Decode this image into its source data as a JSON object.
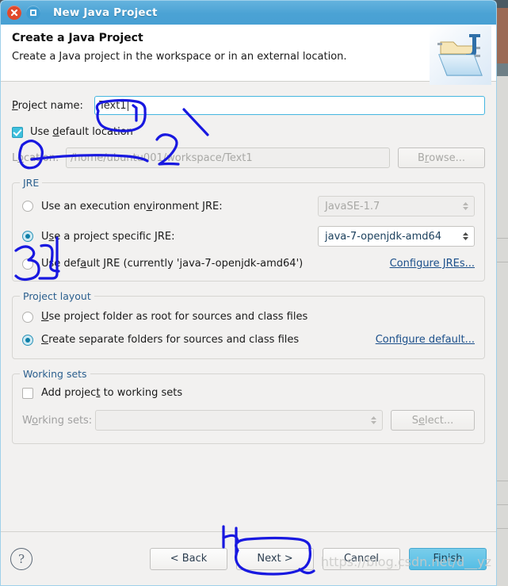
{
  "window": {
    "title": "New Java Project",
    "close_icon": "close-icon",
    "maximize_icon": "maximize-icon"
  },
  "header": {
    "title": "Create a Java Project",
    "subtitle": "Create a Java project in the workspace or in an external location.",
    "icon": "java-project-folder-icon"
  },
  "project": {
    "name_label": "Project name:",
    "name_value": "Text1",
    "use_default_location_label": "Use default location",
    "use_default_location_checked": true,
    "location_label": "Location:",
    "location_value": "/home/ubuntu001/workspace/Text1",
    "location_disabled": true,
    "browse_label": "Browse...",
    "browse_disabled": true
  },
  "jre": {
    "group_label": "JRE",
    "options": [
      {
        "label": "Use an execution environment JRE:",
        "selected": false
      },
      {
        "label": "Use a project specific JRE:",
        "selected": true
      },
      {
        "label": "Use default JRE (currently 'java-7-openjdk-amd64')",
        "selected": false
      }
    ],
    "execution_env_value": "JavaSE-1.7",
    "execution_env_disabled": true,
    "specific_jre_value": "java-7-openjdk-amd64",
    "configure_link": "Configure JREs..."
  },
  "layout": {
    "group_label": "Project layout",
    "options": [
      {
        "label": "Use project folder as root for sources and class files",
        "selected": false
      },
      {
        "label": "Create separate folders for sources and class files",
        "selected": true
      }
    ],
    "configure_link": "Configure default..."
  },
  "working_sets": {
    "group_label": "Working sets",
    "add_label": "Add project to working sets",
    "add_checked": false,
    "sets_label": "Working sets:",
    "sets_value": "",
    "sets_disabled": true,
    "select_label": "Select...",
    "select_disabled": true
  },
  "footer": {
    "help_icon": "help-icon",
    "back_label": "< Back",
    "next_label": "Next >",
    "cancel_label": "Cancel",
    "finish_label": "Finish"
  },
  "watermark": "https://blog.csdn.net/d__yz",
  "annotations": {
    "marker_1": "1",
    "marker_2": "2",
    "marker_3": "3",
    "marker_4": "4",
    "color": "#1818e0"
  },
  "colors": {
    "titlebar": "#4ba2d4",
    "close_button": "#e0492b",
    "accent_field_border": "#45b6e0",
    "primary_button": "#55bde4",
    "annotation": "#1818e0"
  }
}
